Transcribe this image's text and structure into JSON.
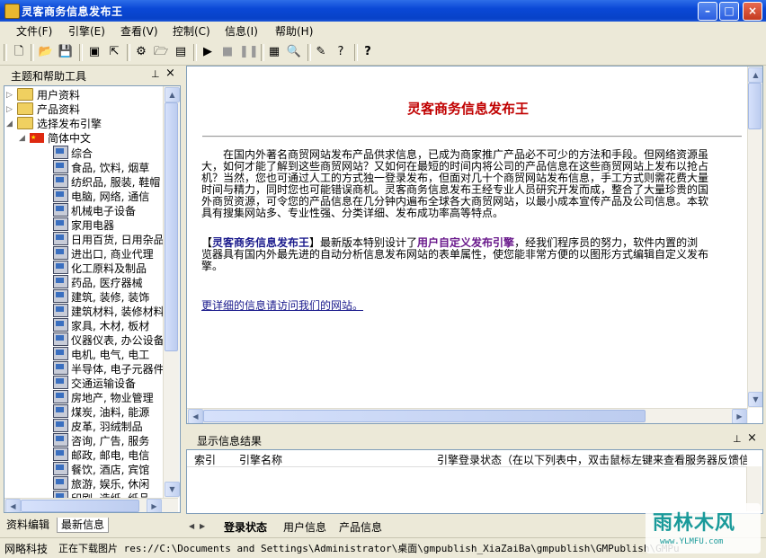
{
  "window": {
    "title": "灵客商务信息发布王"
  },
  "menu": [
    "文件(F)",
    "引擎(E)",
    "查看(V)",
    "控制(C)",
    "信息(I)",
    "帮助(H)"
  ],
  "left_panel": {
    "title": "主题和帮助工具",
    "pin": "ᵖ",
    "close": "×",
    "tree": [
      {
        "label": "用户资料",
        "level": 0,
        "type": "folder"
      },
      {
        "label": "产品资料",
        "level": 0,
        "type": "folder"
      },
      {
        "label": "选择发布引擎",
        "level": 0,
        "type": "folder"
      },
      {
        "label": "简体中文",
        "level": 1,
        "type": "flag"
      },
      {
        "label": "综合",
        "level": 2,
        "type": "pc"
      },
      {
        "label": "食品, 饮料, 烟草",
        "level": 2,
        "type": "pc"
      },
      {
        "label": "纺织品, 服装, 鞋帽",
        "level": 2,
        "type": "pc"
      },
      {
        "label": "电脑, 网络, 通信",
        "level": 2,
        "type": "pc"
      },
      {
        "label": "机械电子设备",
        "level": 2,
        "type": "pc"
      },
      {
        "label": "家用电器",
        "level": 2,
        "type": "pc"
      },
      {
        "label": "日用百货, 日用杂品",
        "level": 2,
        "type": "pc"
      },
      {
        "label": "进出口, 商业代理",
        "level": 2,
        "type": "pc"
      },
      {
        "label": "化工原料及制品",
        "level": 2,
        "type": "pc"
      },
      {
        "label": "药品, 医疗器械",
        "level": 2,
        "type": "pc"
      },
      {
        "label": "建筑, 装修, 装饰",
        "level": 2,
        "type": "pc"
      },
      {
        "label": "建筑材料, 装修材料",
        "level": 2,
        "type": "pc"
      },
      {
        "label": "家具, 木材, 板材",
        "level": 2,
        "type": "pc"
      },
      {
        "label": "仪器仪表, 办公设备",
        "level": 2,
        "type": "pc"
      },
      {
        "label": "电机, 电气, 电工",
        "level": 2,
        "type": "pc"
      },
      {
        "label": "半导体, 电子元器件",
        "level": 2,
        "type": "pc"
      },
      {
        "label": "交通运输设备",
        "level": 2,
        "type": "pc"
      },
      {
        "label": "房地产, 物业管理",
        "level": 2,
        "type": "pc"
      },
      {
        "label": "煤炭, 油料, 能源",
        "level": 2,
        "type": "pc"
      },
      {
        "label": "皮革, 羽绒制品",
        "level": 2,
        "type": "pc"
      },
      {
        "label": "咨询, 广告, 服务",
        "level": 2,
        "type": "pc"
      },
      {
        "label": "邮政, 邮电, 电信",
        "level": 2,
        "type": "pc"
      },
      {
        "label": "餐饮, 酒店, 宾馆",
        "level": 2,
        "type": "pc"
      },
      {
        "label": "旅游, 娱乐, 休闲",
        "level": 2,
        "type": "pc"
      },
      {
        "label": "印刷, 造纸, 纸品",
        "level": 2,
        "type": "pc"
      }
    ],
    "tabs": [
      "资料编辑",
      "最新信息"
    ]
  },
  "content": {
    "heading": "灵客商务信息发布王",
    "para1": [
      "　　在国内外著名商贸网站发布产品供求信息，已成为商家推广产品必不可少的方法和手段。但网络资源虽",
      "大，如何才能了解到这些商贸网站？又如何在最短的时间内将公司的产品信息在这些商贸网站上发布以抢占",
      "机？当然，您也可通过人工的方式独一登录发布，但面对几十个商贸网站发布信息，手工方式则需花费大量",
      "时间与精力，同时您也可能错误商机。灵客商务信息发布王经专业人员研究开发而成，整合了大量珍贵的国",
      "外商贸资源，可令您的产品信息在几分钟内遍布全球各大商贸网站，以最小成本宣传产品及公司信息。本软",
      "具有搜集网站多、专业性强、分类详细、发布成功率高等特点。"
    ],
    "para2_prefix": "【",
    "para2_bold1": "灵客商务信息发布王",
    "para2_mid1": "】最新版本特别设计了",
    "para2_bold2": "用户自定义发布引擎",
    "para2_mid2": "，经我们程序员的努力，软件内置的浏",
    "para2_line2": "览器具有国内外最先进的自动分析信息发布网站的表单属性，使您能非常方便的以图形方式编辑自定义发布",
    "para2_line3": "擎。",
    "link": "更详细的信息请访问我们的网站。"
  },
  "output": {
    "title": "显示信息结果",
    "columns": [
      "索引",
      "引擎名称",
      "引擎登录状态（在以下列表中，双击鼠标左键来查看服务器反馈信"
    ]
  },
  "bottom_tabs": [
    "登录状态",
    "用户信息",
    "产品信息"
  ],
  "status": {
    "left": "网略科技",
    "right": "正在下载图片 res://C:\\Documents and Settings\\Administrator\\桌面\\gmpublish_XiaZaiBa\\gmpublish\\GMPublish\\GMPublish"
  },
  "watermark": {
    "main": "雨林木风",
    "sub": "www.YLMFU.com"
  }
}
